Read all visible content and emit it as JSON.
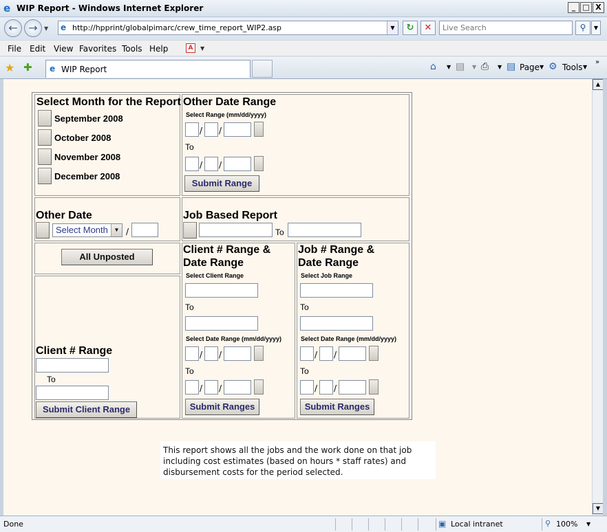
{
  "window": {
    "title": "WIP Report - Windows Internet Explorer",
    "controls": [
      "_",
      "□",
      "X"
    ]
  },
  "address": {
    "url": "http://hpprint/globalpimarc/crew_time_report_WIP2.asp",
    "search_placeholder": "Live Search"
  },
  "menu": {
    "items": [
      "File",
      "Edit",
      "View",
      "Favorites",
      "Tools",
      "Help"
    ]
  },
  "tabbar": {
    "tab_label": "WIP Report",
    "commands": {
      "page": "Page",
      "tools": "Tools"
    }
  },
  "form": {
    "select_month": {
      "heading": "Select Month for the Report",
      "months": [
        "September  2008",
        "October  2008",
        "November  2008",
        "December  2008"
      ]
    },
    "other_date_range": {
      "heading": "Other Date Range",
      "sublabel": "Select Range (mm/dd/yyyy)",
      "to": "To",
      "submit": "Submit Range"
    },
    "other_date": {
      "heading": "Other Date",
      "select_value": "Select Month",
      "slash": "/"
    },
    "job_based": {
      "heading": "Job Based Report",
      "to": "To"
    },
    "all_unposted": "All Unposted",
    "client_date_range": {
      "heading_line1": "Client # Range &",
      "heading_line2": "Date Range",
      "client_label": "Select Client Range",
      "to": "To",
      "date_label": "Select Date Range (mm/dd/yyyy)",
      "to2": "To",
      "submit": "Submit Ranges"
    },
    "job_date_range": {
      "heading_line1": "Job # Range &",
      "heading_line2": "Date Range",
      "job_label": "Select Job Range",
      "to": "To",
      "date_label": "Select Date Range (mm/dd/yyyy)",
      "to2": "To",
      "submit": "Submit Ranges"
    },
    "client_range": {
      "heading": "Client # Range",
      "to": "To",
      "submit": "Submit Client Range"
    },
    "slash": "/"
  },
  "description": {
    "line1": "This report shows all the jobs and the work done on that job",
    "line2": "including cost estimates (based on hours * staff rates) and",
    "line3": "disbursement costs for the period selected."
  },
  "status": {
    "text": "Done",
    "zone": "Local intranet",
    "zoom": "100%"
  }
}
